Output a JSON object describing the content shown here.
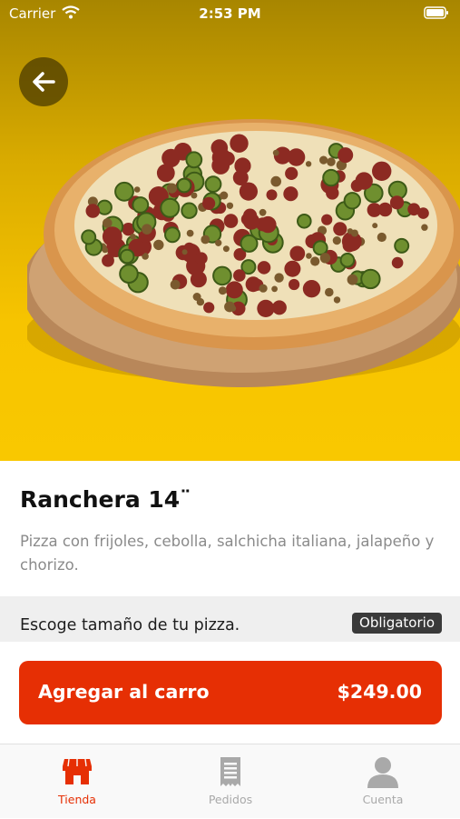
{
  "status_bar": {
    "carrier": "Carrier",
    "time": "2:53 PM"
  },
  "product": {
    "name": "Ranchera 14¨",
    "description": "Pizza con frijoles, cebolla, salchicha italiana, jalapeño y chorizo."
  },
  "size_selector": {
    "label": "Escoge tamaño de tu pizza.",
    "badge": "Obligatorio"
  },
  "cart_button": {
    "label": "Agregar al carro",
    "price": "$249.00"
  },
  "tabs": [
    {
      "label": "Tienda",
      "icon": "store-icon",
      "active": true
    },
    {
      "label": "Pedidos",
      "icon": "receipt-icon",
      "active": false
    },
    {
      "label": "Cuenta",
      "icon": "user-icon",
      "active": false
    }
  ],
  "colors": {
    "accent": "#e62f04",
    "hero_yellow": "#f9c800",
    "tab_inactive": "#a9a9a9"
  }
}
